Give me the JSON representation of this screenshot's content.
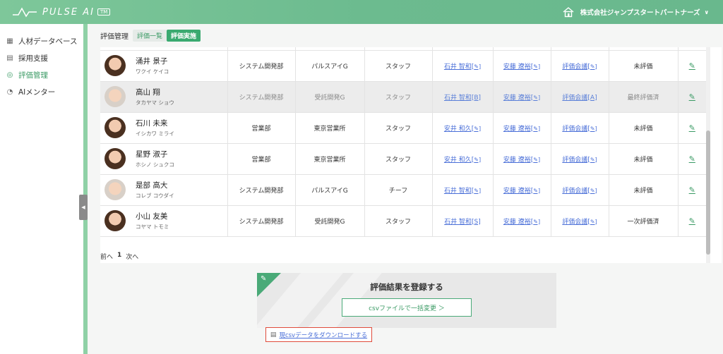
{
  "header": {
    "app_name": "PULSE AI",
    "badge": "TM",
    "company": "株式会社ジャンプスタートパートナーズ"
  },
  "sidebar": {
    "items": [
      {
        "label": "人材データベース",
        "icon": "grid-icon",
        "active": false
      },
      {
        "label": "採用支援",
        "icon": "document-icon",
        "active": false
      },
      {
        "label": "評価管理",
        "icon": "badge-icon",
        "active": true
      },
      {
        "label": "AIメンター",
        "icon": "head-icon",
        "active": false
      }
    ]
  },
  "breadcrumb": {
    "title": "評価管理",
    "tabs": [
      {
        "label": "評価一覧",
        "active": false
      },
      {
        "label": "評価実施",
        "active": true
      }
    ]
  },
  "table": {
    "rows": [
      {
        "name": "涌井 景子",
        "kana": "ワクイ ケイコ",
        "dept": "システム開発部",
        "group": "パルスアイG",
        "role": "スタッフ",
        "evaluator1": "石井 智和[",
        "evaluator2": "安藤 遼裕[",
        "meeting": "評価会議[",
        "status": "未評価",
        "dim": false,
        "avatar_light": false
      },
      {
        "name": "高山 翔",
        "kana": "タカヤマ ショウ",
        "dept": "システム開発部",
        "group": "受託開発G",
        "role": "スタッフ",
        "evaluator1": "石井 智和[B]",
        "evaluator2": "安藤 遼裕[",
        "meeting": "評価会議[A]",
        "status": "最終評価済",
        "dim": true,
        "avatar_light": true
      },
      {
        "name": "石川 未来",
        "kana": "イシカワ ミライ",
        "dept": "営業部",
        "group": "東京営業所",
        "role": "スタッフ",
        "evaluator1": "安井 和久[",
        "evaluator2": "安藤 遼裕[",
        "meeting": "評価会議[",
        "status": "未評価",
        "dim": false,
        "avatar_light": false
      },
      {
        "name": "星野 淑子",
        "kana": "ホシノ シュクコ",
        "dept": "営業部",
        "group": "東京営業所",
        "role": "スタッフ",
        "evaluator1": "安井 和久[",
        "evaluator2": "安藤 遼裕[",
        "meeting": "評価会議[",
        "status": "未評価",
        "dim": false,
        "avatar_light": false
      },
      {
        "name": "是部 高大",
        "kana": "コレブ コウダイ",
        "dept": "システム開発部",
        "group": "パルスアイG",
        "role": "チーフ",
        "evaluator1": "石井 智和[",
        "evaluator2": "安藤 遼裕[",
        "meeting": "評価会議[",
        "status": "未評価",
        "dim": false,
        "avatar_light": true
      },
      {
        "name": "小山 友美",
        "kana": "コヤマ トモミ",
        "dept": "システム開発部",
        "group": "受託開発G",
        "role": "スタッフ",
        "evaluator1": "石井 智和[S]",
        "evaluator2": "安藤 遼裕[",
        "meeting": "評価会議[",
        "status": "一次評価済",
        "dim": false,
        "avatar_light": false
      }
    ]
  },
  "pager": {
    "prev": "前へ",
    "current": "1",
    "next": "次へ"
  },
  "register": {
    "title": "評価結果を登録する",
    "csv_button": "csvファイルで一括変更 ＞",
    "download_link": "現csvデータをダウンロードする"
  }
}
